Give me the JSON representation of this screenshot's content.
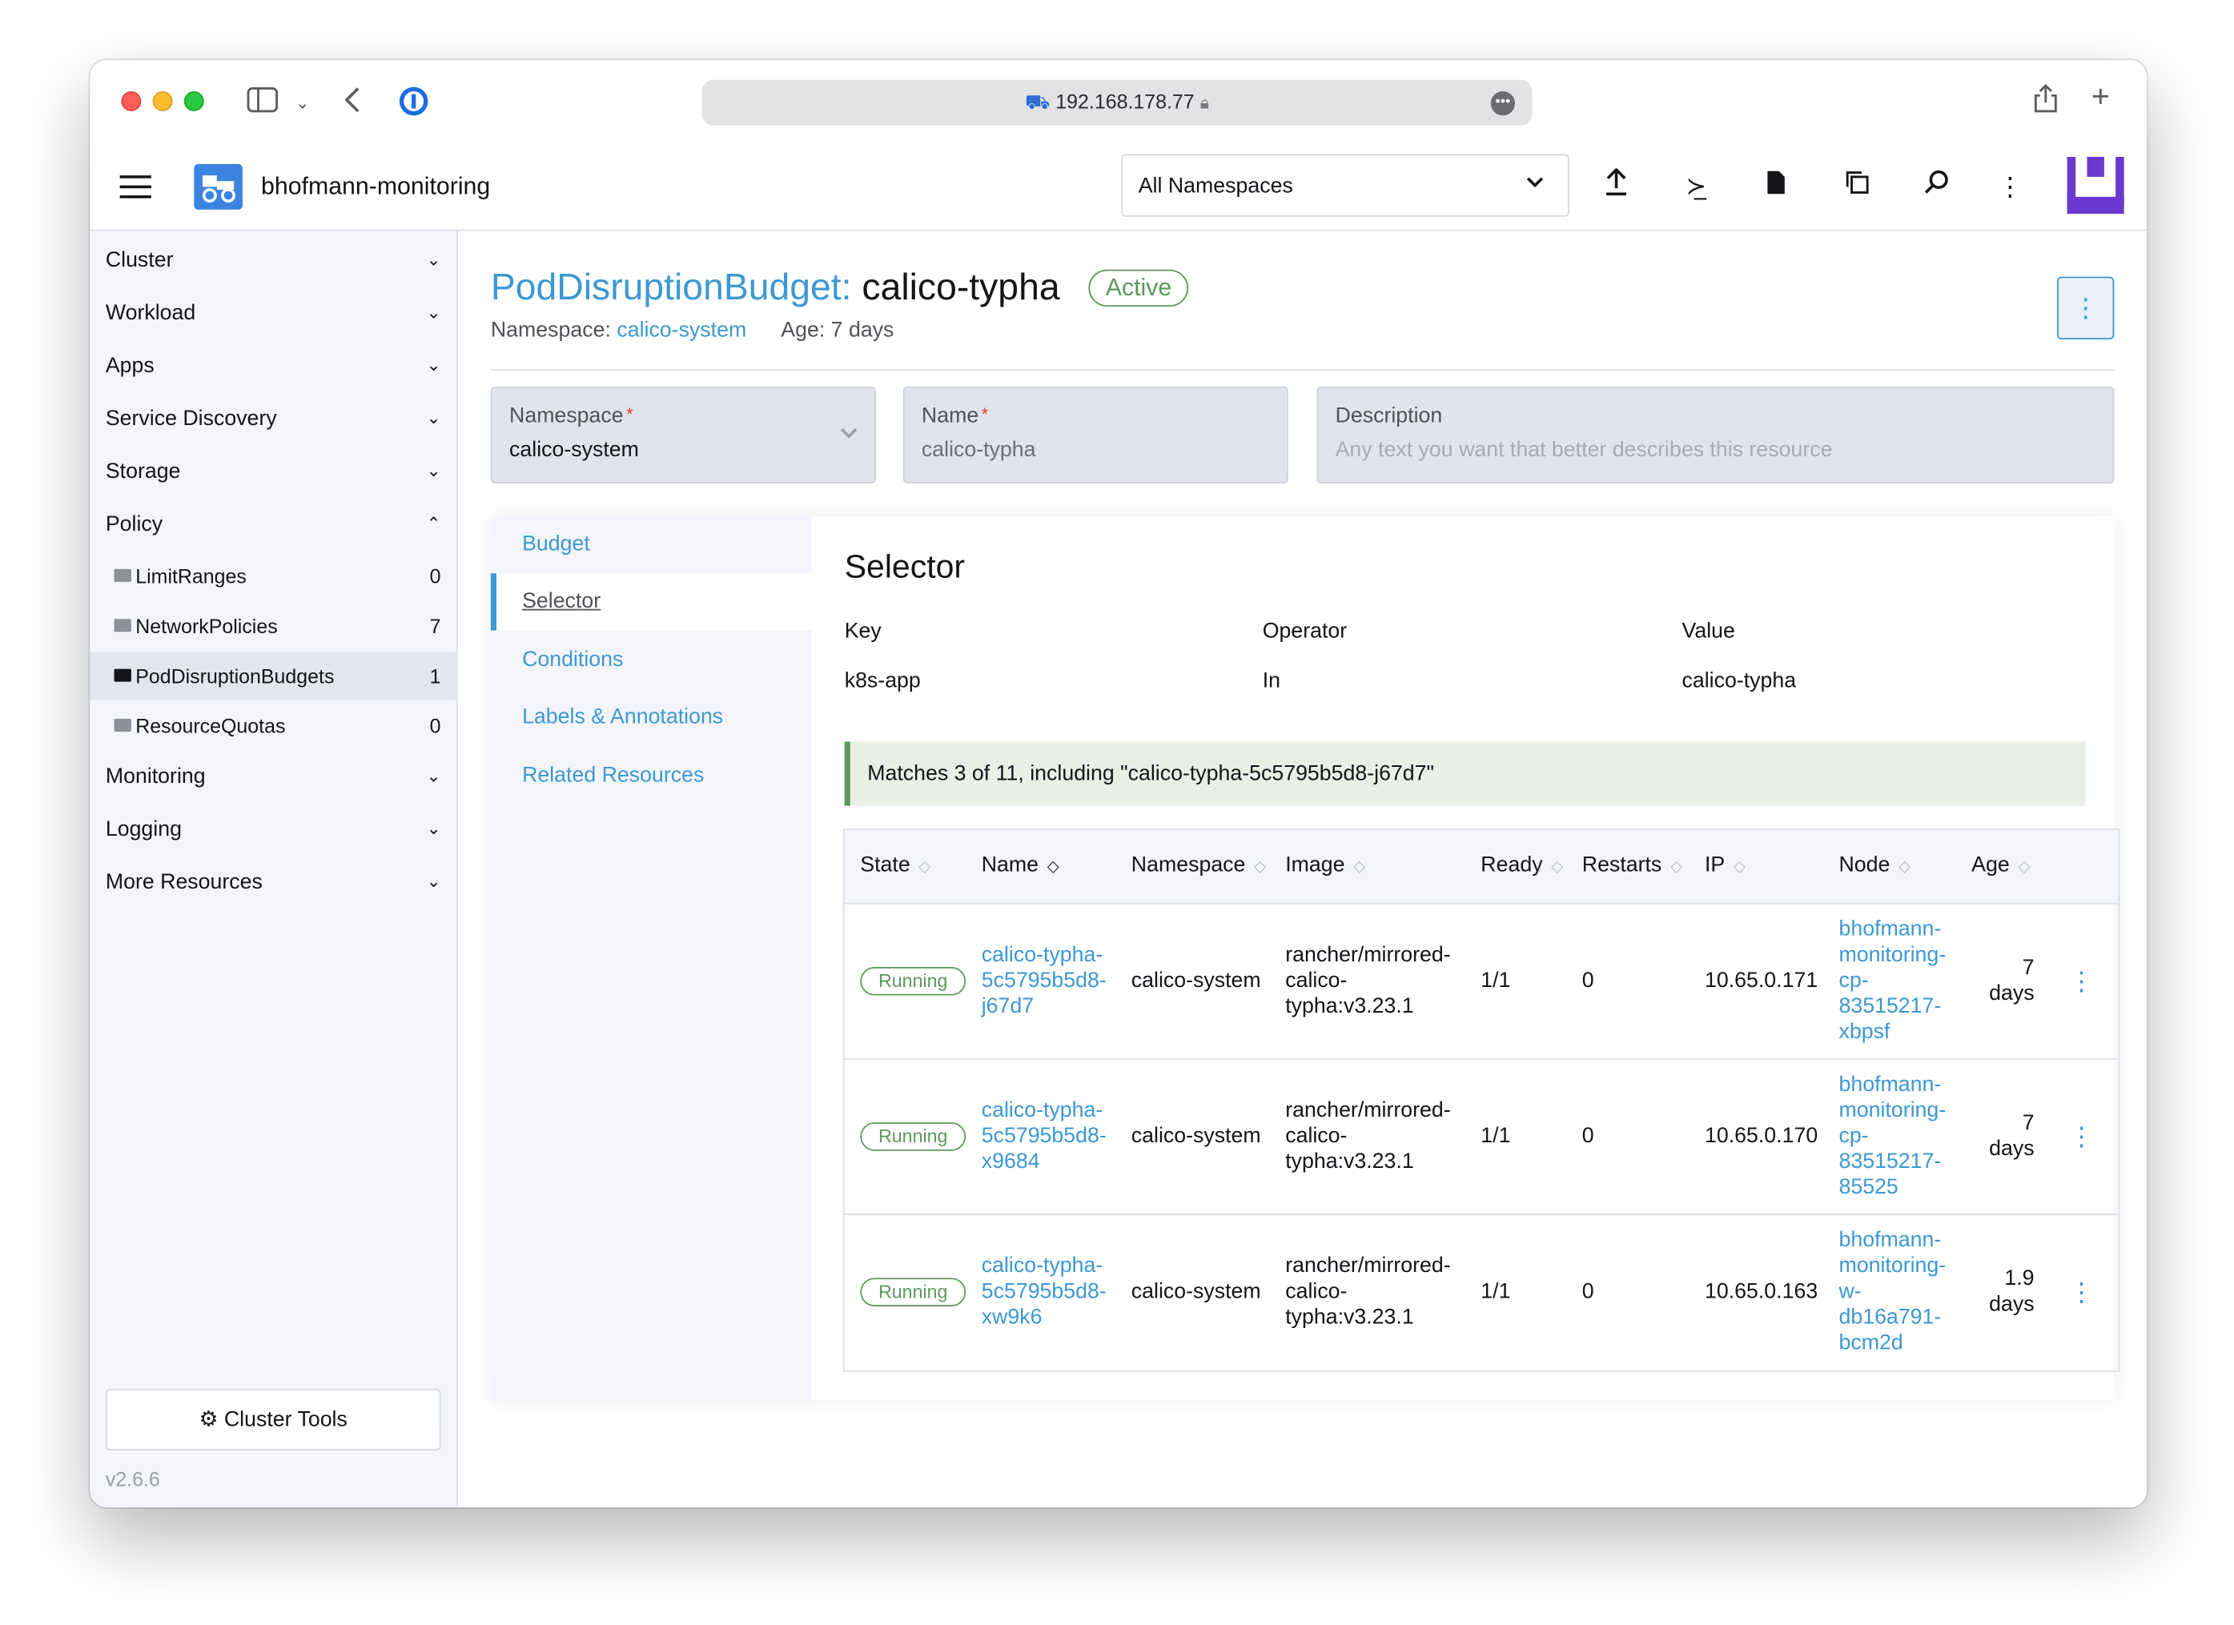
{
  "browser": {
    "url": "192.168.178.77",
    "icons": [
      "sidebar-toggle-icon",
      "chevron-down-icon",
      "back-icon",
      "password-manager-icon",
      "lock-icon",
      "more-icon",
      "share-icon",
      "new-tab-icon"
    ]
  },
  "header": {
    "cluster_name": "bhofmann-monitoring",
    "namespace_selector": "All Namespaces",
    "icons": [
      "upload-icon",
      "terminal-icon",
      "file-icon",
      "copy-config-icon",
      "search-icon",
      "more-vertical-icon"
    ]
  },
  "sidebar": {
    "groups_top": [
      {
        "label": "Cluster",
        "expanded": false
      },
      {
        "label": "Workload",
        "expanded": false
      },
      {
        "label": "Apps",
        "expanded": false
      },
      {
        "label": "Service Discovery",
        "expanded": false
      },
      {
        "label": "Storage",
        "expanded": false
      },
      {
        "label": "Policy",
        "expanded": true
      }
    ],
    "policy_items": [
      {
        "label": "LimitRanges",
        "count": "0",
        "active": false
      },
      {
        "label": "NetworkPolicies",
        "count": "7",
        "active": false
      },
      {
        "label": "PodDisruptionBudgets",
        "count": "1",
        "active": true
      },
      {
        "label": "ResourceQuotas",
        "count": "0",
        "active": false
      }
    ],
    "groups_bottom": [
      {
        "label": "Monitoring",
        "expanded": false
      },
      {
        "label": "Logging",
        "expanded": false
      },
      {
        "label": "More Resources",
        "expanded": false
      }
    ],
    "cluster_tools": "Cluster Tools",
    "version": "v2.6.6"
  },
  "resource": {
    "kind": "PodDisruptionBudget:",
    "name": "calico-typha",
    "state": "Active",
    "namespace_label": "Namespace:",
    "namespace": "calico-system",
    "age": "Age: 7 days"
  },
  "form": {
    "namespace_label": "Namespace",
    "namespace_value": "calico-system",
    "name_label": "Name",
    "name_value": "calico-typha",
    "description_label": "Description",
    "description_placeholder": "Any text you want that better describes this resource",
    "required_mark": "*"
  },
  "tabs": [
    "Budget",
    "Selector",
    "Conditions",
    "Labels & Annotations",
    "Related Resources"
  ],
  "active_tab": "Selector",
  "selector": {
    "title": "Selector",
    "headers": {
      "key": "Key",
      "operator": "Operator",
      "value": "Value"
    },
    "row": {
      "key": "k8s-app",
      "operator": "In",
      "value": "calico-typha"
    },
    "matches": "Matches 3 of 11, including \"calico-typha-5c5795b5d8-j67d7\""
  },
  "pods": {
    "columns": [
      "State",
      "Name",
      "Namespace",
      "Image",
      "Ready",
      "Restarts",
      "IP",
      "Node",
      "Age"
    ],
    "rows": [
      {
        "state": "Running",
        "name": [
          "calico-typha-",
          "5c5795b5d8-",
          "j67d7"
        ],
        "namespace": "calico-system",
        "image": [
          "rancher/mirrored-",
          "calico-",
          "typha:v3.23.1"
        ],
        "ready": "1/1",
        "restarts": "0",
        "ip": "10.65.0.171",
        "node": [
          "bhofmann-",
          "monitoring-",
          "cp-",
          "83515217-",
          "xbpsf"
        ],
        "age": [
          "7",
          "days"
        ]
      },
      {
        "state": "Running",
        "name": [
          "calico-typha-",
          "5c5795b5d8-",
          "x9684"
        ],
        "namespace": "calico-system",
        "image": [
          "rancher/mirrored-",
          "calico-",
          "typha:v3.23.1"
        ],
        "ready": "1/1",
        "restarts": "0",
        "ip": "10.65.0.170",
        "node": [
          "bhofmann-",
          "monitoring-",
          "cp-",
          "83515217-",
          "85525"
        ],
        "age": [
          "7",
          "days"
        ]
      },
      {
        "state": "Running",
        "name": [
          "calico-typha-",
          "5c5795b5d8-",
          "xw9k6"
        ],
        "namespace": "calico-system",
        "image": [
          "rancher/mirrored-",
          "calico-",
          "typha:v3.23.1"
        ],
        "ready": "1/1",
        "restarts": "0",
        "ip": "10.65.0.163",
        "node": [
          "bhofmann-",
          "monitoring-",
          "w-",
          "db16a791-",
          "bcm2d"
        ],
        "age": [
          "1.9",
          "days"
        ]
      }
    ]
  },
  "colors": {
    "link": "#3d98d3",
    "success": "#5d995d",
    "brand": "#3d84e0",
    "avatar": "#6a3ad0"
  }
}
